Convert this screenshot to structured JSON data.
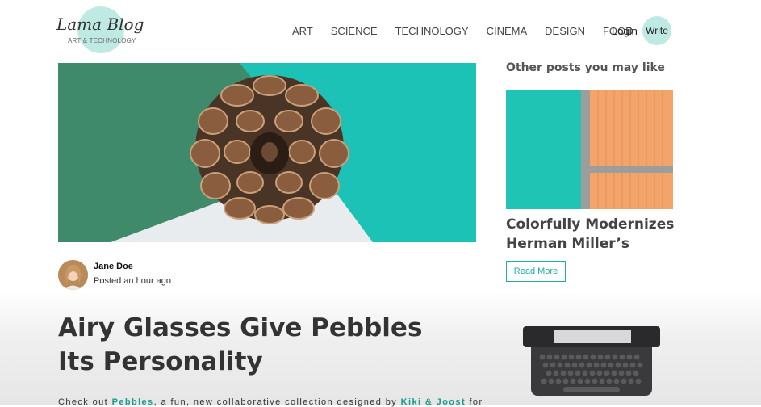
{
  "logo": {
    "title": "Lama Blog",
    "subtitle": "ART & TECHNOLOGY"
  },
  "nav": {
    "items": [
      "ART",
      "SCIENCE",
      "TECHNOLOGY",
      "CINEMA",
      "DESIGN",
      "FOOD"
    ],
    "login": "Login",
    "write": "Write"
  },
  "post": {
    "author": "Jane Doe",
    "posted": "Posted an hour ago",
    "title": "Airy Glasses Give Pebbles Its Personality",
    "body": {
      "prefix": "Check out ",
      "link1": "Pebbles",
      "middle": ", a fun, new collaborative collection designed by ",
      "link2": "Kiki & Joost",
      "suffix": " for"
    }
  },
  "sidebar": {
    "heading": "Other posts you may like",
    "card_title": "Colorfully Modernizes Herman Miller’s",
    "read_more": "Read More"
  },
  "colors": {
    "accent": "#1cae9f",
    "logo_circle": "#bfe9e3",
    "teal": "#1cc2b5",
    "green": "#3e8a6a",
    "orange": "#f3a46b"
  }
}
